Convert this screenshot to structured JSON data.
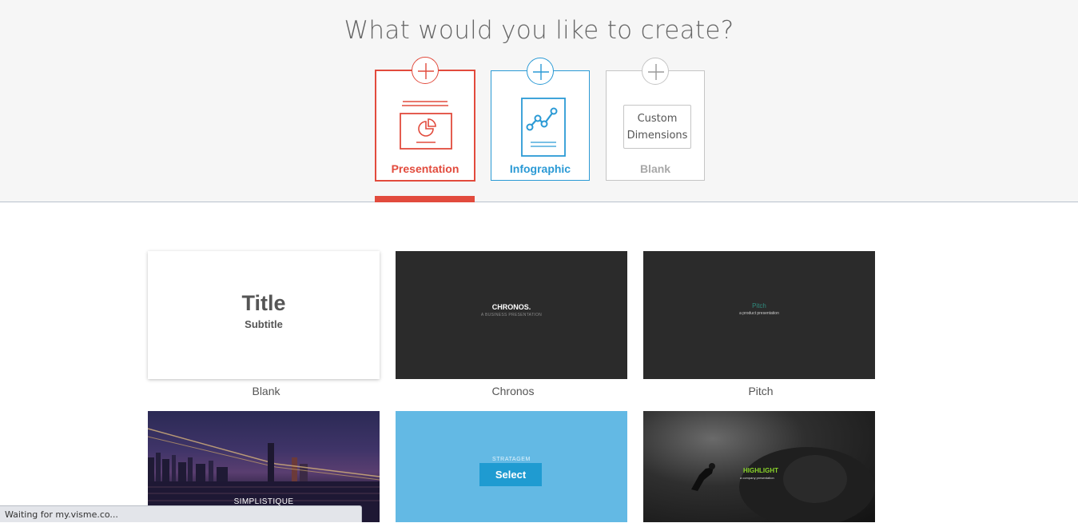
{
  "page": {
    "heading": "What would you like to create?"
  },
  "types": {
    "presentation": {
      "label": "Presentation",
      "color": "#e24b3d",
      "icon": "presentation-icon"
    },
    "infographic": {
      "label": "Infographic",
      "color": "#2b9ad5",
      "icon": "infographic-icon"
    },
    "blank": {
      "label": "Blank",
      "box_line1": "Custom",
      "box_line2": "Dimensions",
      "color": "#a8a8a8"
    }
  },
  "templates": {
    "blank": {
      "name": "Blank",
      "preview_title": "Title",
      "preview_subtitle": "Subtitle"
    },
    "chronos": {
      "name": "Chronos",
      "preview_title": "CHRONOS.",
      "preview_subtitle": "A BUSINESS PRESENTATION"
    },
    "pitch": {
      "name": "Pitch",
      "preview_title": "Pitch",
      "preview_subtitle": "a product presentation"
    },
    "simplistique": {
      "preview_title": "SIMPLISTIQUE"
    },
    "stratagem": {
      "preview_title": "STRATAGEM",
      "select_label": "Select"
    },
    "highlight": {
      "preview_title": "HIGHLIGHT",
      "preview_subtitle": "a company presentation"
    }
  },
  "status": {
    "text": "Waiting for my.visme.co..."
  }
}
